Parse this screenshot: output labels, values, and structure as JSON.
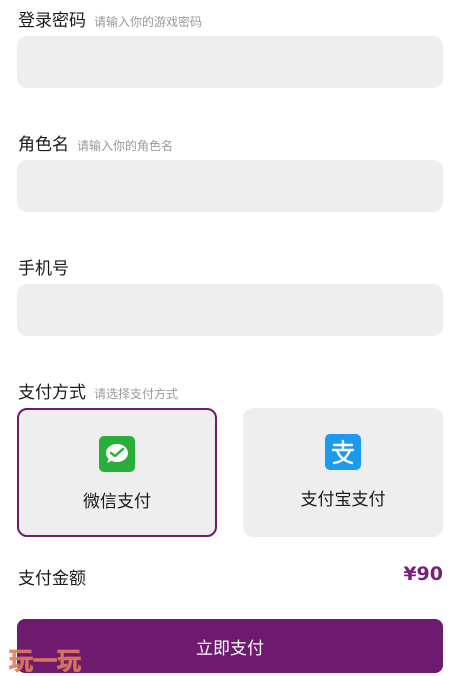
{
  "form": {
    "password": {
      "label": "登录密码",
      "hint": "请输入你的游戏密码",
      "value": ""
    },
    "role": {
      "label": "角色名",
      "hint": "请输入你的角色名",
      "value": ""
    },
    "phone": {
      "label": "手机号",
      "value": ""
    }
  },
  "payment": {
    "label": "支付方式",
    "hint": "请选择支付方式",
    "methods": [
      {
        "name": "微信支付",
        "icon": "wechat-pay-icon",
        "color": "#2aae3a",
        "selected": true
      },
      {
        "name": "支付宝支付",
        "icon": "alipay-icon",
        "color": "#1a9bf0",
        "selected": false
      }
    ]
  },
  "amount": {
    "label": "支付金额",
    "value": "¥90"
  },
  "submit": {
    "label": "立即支付"
  },
  "watermark": {
    "text": "玩一玩"
  },
  "colors": {
    "accent": "#6e1a6e",
    "amount": "#7a1f78",
    "field_bg": "#eeeeee"
  }
}
